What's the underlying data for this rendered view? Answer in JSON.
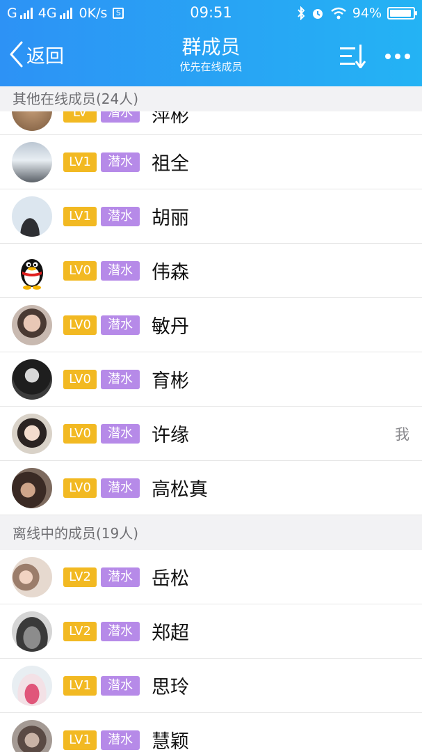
{
  "status_bar": {
    "carrier1": "G",
    "carrier2": "4G",
    "speed": "0K/s",
    "time": "09:51",
    "battery_text": "94%",
    "battery_level": 0.94
  },
  "header": {
    "back_label": "返回",
    "title": "群成员",
    "subtitle": "优先在线成员"
  },
  "online_section": {
    "header": "其他在线成员(24人)",
    "partial_row": {
      "level": "LV",
      "role": "潜水",
      "name": "萍彬"
    },
    "members": [
      {
        "level": "LV1",
        "role": "潜水",
        "name": "祖全",
        "avatar": "snow-landscape"
      },
      {
        "level": "LV1",
        "role": "潜水",
        "name": "胡丽",
        "avatar": "silhouette"
      },
      {
        "level": "LV0",
        "role": "潜水",
        "name": "伟森",
        "avatar": "qq-penguin"
      },
      {
        "level": "LV0",
        "role": "潜水",
        "name": "敏丹",
        "avatar": "person"
      },
      {
        "level": "LV0",
        "role": "潜水",
        "name": "育彬",
        "avatar": "person-dark"
      },
      {
        "level": "LV0",
        "role": "潜水",
        "name": "许缘",
        "avatar": "person",
        "tag": "我"
      },
      {
        "level": "LV0",
        "role": "潜水",
        "name": "高松真",
        "avatar": "person-dark"
      }
    ]
  },
  "offline_section": {
    "header": "离线中的成员(19人)",
    "members": [
      {
        "level": "LV2",
        "role": "潜水",
        "name": "岳松",
        "avatar": "person"
      },
      {
        "level": "LV2",
        "role": "潜水",
        "name": "郑超",
        "avatar": "person-dark"
      },
      {
        "level": "LV1",
        "role": "潜水",
        "name": "思玲",
        "avatar": "cake"
      },
      {
        "level": "LV1",
        "role": "潜水",
        "name": "慧颖",
        "avatar": "person"
      }
    ]
  },
  "colors": {
    "header_gradient_start": "#2d92f5",
    "header_gradient_end": "#24b3f4",
    "level_badge": "#f2b922",
    "role_badge": "#b68ae8"
  }
}
